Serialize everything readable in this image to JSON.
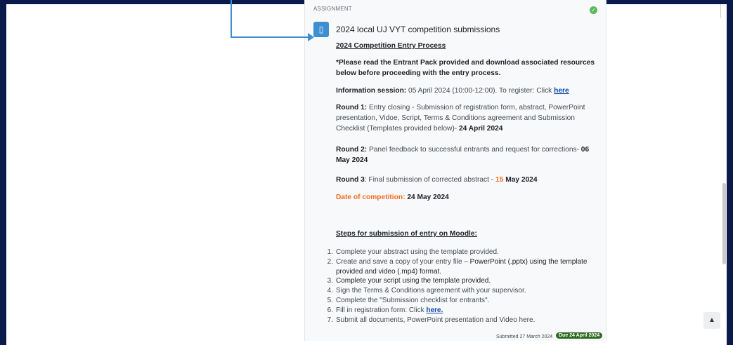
{
  "activity": {
    "label": "ASSIGNMENT",
    "title": "2024 local UJ VYT competition submissions"
  },
  "content": {
    "heading": "2024 Competition Entry Process",
    "notice": "*Please read the Entrant Pack provided and download associated resources below before proceeding with the entry process.",
    "info_label": "Information session:",
    "info_text": " 05 April 2024 (10:00-12:00). To register: Click ",
    "info_link": "here",
    "round1_label": "Round 1:",
    "round1_text": " Entry closing - Submission of registration form, abstract, PowerPoint presentation, Vidoe, Script, Terms & Conditions agreement and Submission Checklist (Templates provided below)- ",
    "round1_date": "24 April 2024",
    "round2_label": "Round 2:",
    "round2_text": " Panel feedback to successful entrants and request for corrections- ",
    "round2_date": "06 May 2024",
    "round3_label": "Round 3",
    "round3_text": ": Final submission of corrected abstract - ",
    "round3_date_a": "15",
    "round3_date_b": " May 2024",
    "competition_label": "Date of competition:",
    "competition_date": " 24 May 2024",
    "steps_heading": "Steps for submission of entry on Moodle:"
  },
  "steps": [
    {
      "num": "1.",
      "text": "Complete your abstract using the template provided."
    },
    {
      "num": "2.",
      "text_a": "Create and save a copy of your entry file – ",
      "text_b": "PowerPoint (.pptx) using the template provided and video (.mp4) format."
    },
    {
      "num": "3.",
      "text": "Complete your script using the template provided."
    },
    {
      "num": "4.",
      "text": "Sign the Terms & Conditions agreement with your supervisor."
    },
    {
      "num": "5.",
      "text": "Complete the \"Submission checklist for entrants\"."
    },
    {
      "num": "6.",
      "text": "Fill in registration form: Click ",
      "link": "here."
    },
    {
      "num": "7.",
      "text": "Submit all documents, PowerPoint presentation and Video here."
    }
  ],
  "footer": {
    "submitted": "Submitted 27 March 2024",
    "due": "Due 24 April 2024"
  },
  "icons": {
    "completion": "check-icon",
    "activity": "document-icon",
    "back_to_top": "arrow-up-icon"
  },
  "colors": {
    "background": "#0a1a4a",
    "accent_blue": "#3d8fd1",
    "orange": "#f26d21",
    "due_badge": "#2d6a21",
    "complete_green": "#5cb85c"
  }
}
